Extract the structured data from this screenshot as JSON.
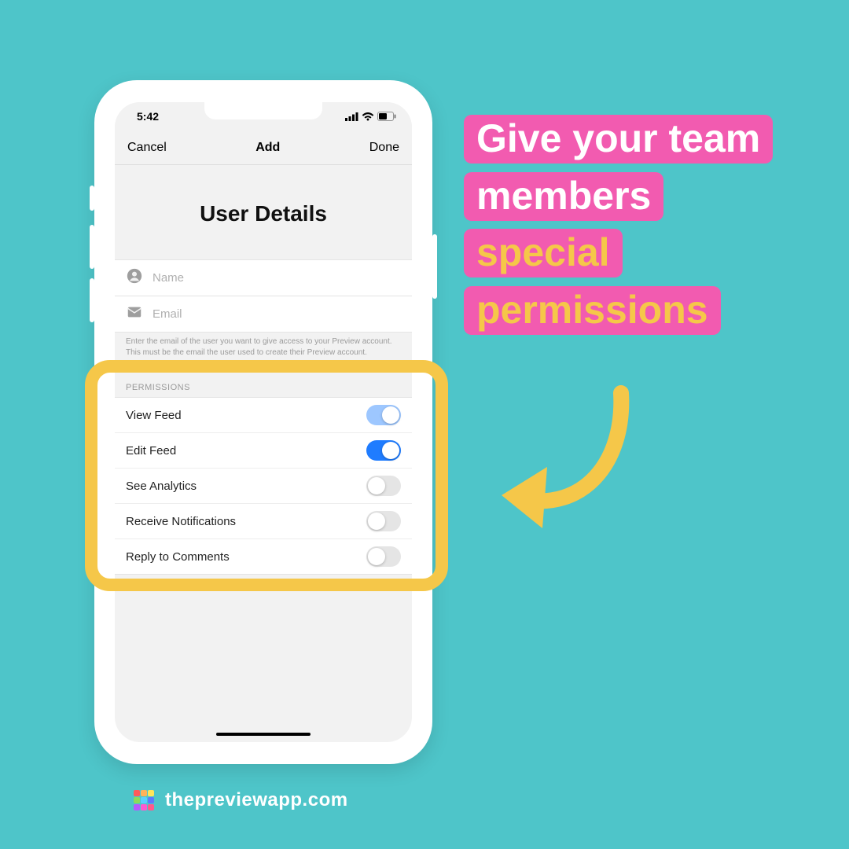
{
  "statusbar": {
    "time": "5:42"
  },
  "navbar": {
    "cancel": "Cancel",
    "title": "Add",
    "done": "Done"
  },
  "page": {
    "title": "User Details"
  },
  "fields": {
    "name_placeholder": "Name",
    "email_placeholder": "Email",
    "helper": "Enter the email of the user you want to give access to your Preview account. This must be the email the user used to create their Preview account."
  },
  "permissions": {
    "label": "PERMISSIONS",
    "items": [
      {
        "label": "View Feed",
        "on": true,
        "light": true
      },
      {
        "label": "Edit Feed",
        "on": true,
        "light": false
      },
      {
        "label": "See Analytics",
        "on": false,
        "light": false
      },
      {
        "label": "Receive Notifications",
        "on": false,
        "light": false
      },
      {
        "label": "Reply to Comments",
        "on": false,
        "light": false
      }
    ]
  },
  "callout": {
    "line1": "Give your team",
    "line2": "members",
    "line3": "special",
    "line4": "permissions"
  },
  "footer": {
    "url": "thepreviewapp.com"
  }
}
